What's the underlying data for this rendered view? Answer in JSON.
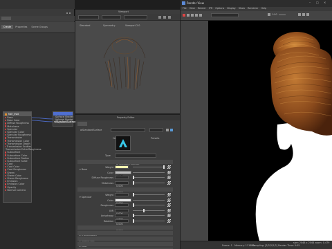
{
  "left_panel": {
    "tabs": [
      "Create",
      "Properties",
      "Scene Groups"
    ],
    "active_tab": "Create",
    "node_main": {
      "title": "hair_mat",
      "ports": [
        "Base",
        "Base Color",
        "Diffuse Roughness",
        "Metalness",
        "Specular",
        "Specular Color",
        "Specular Roughness",
        "Transmission",
        "Transmission Color",
        "Transmission Depth",
        "Transmission Scatter",
        "Transmission Extra Roughness",
        "Subsurface",
        "Subsurface Color",
        "Subsurface Radius",
        "Subsurface Scale",
        "Coat",
        "Coat Color",
        "Coat Roughness",
        "Sheen",
        "Sheen Color",
        "Sheen Roughness",
        "Emission",
        "Emission Color",
        "Opacity",
        "Normal Camera"
      ]
    },
    "node_shading": {
      "title": "aiStandardSurfaceSG",
      "ports": [
        "Surface Shader",
        "Volume Shader",
        "Displacement Shader"
      ]
    }
  },
  "viewport": {
    "title": "Viewport",
    "menus": [
      "View",
      "Shading",
      "Lighting",
      "Show",
      "Renderer",
      "Panels"
    ],
    "toolbar_dropdowns": [
      "Standard",
      "Symmetry",
      "Viewport 2.0"
    ]
  },
  "property_editor": {
    "title": "Property Editor",
    "node_label": "aiStandardSurface",
    "node_value": "Hair",
    "presets_label": "Presets",
    "type_label": "Type",
    "type_value": "ai Standard Surface",
    "sections": [
      {
        "name": "Base",
        "open": true,
        "rows": [
          {
            "label": "Weight",
            "value": "1.000",
            "highlight": true,
            "level": 1.0
          },
          {
            "label": "Color",
            "value": "",
            "swatch": "#bfbfbf"
          },
          {
            "label": "Diffuse Roughness",
            "value": "0.000",
            "level": 0.0
          },
          {
            "label": "Metalness",
            "value": "0.000",
            "level": 0.0
          }
        ]
      },
      {
        "name": "Specular",
        "open": true,
        "rows": [
          {
            "label": "Weight",
            "value": "0.000",
            "level": 0.0
          },
          {
            "label": "Color",
            "value": "",
            "swatch": "#e6e6e6"
          },
          {
            "label": "Roughness",
            "value": "0.000",
            "level": 0.0
          },
          {
            "label": "IOR",
            "value": "1.500",
            "level": 0.33
          },
          {
            "label": "Anisotropy",
            "value": "0.000",
            "level": 0.0
          },
          {
            "label": "Rotation",
            "value": "0.000",
            "level": 0.0
          }
        ]
      },
      {
        "name": "Transmission",
        "open": false,
        "rows": []
      },
      {
        "name": "Subsurface",
        "open": false,
        "rows": []
      },
      {
        "name": "Coat",
        "open": false,
        "rows": []
      },
      {
        "name": "Sheen",
        "open": false,
        "rows": []
      },
      {
        "name": "Emission",
        "open": false,
        "rows": []
      }
    ]
  },
  "render_view": {
    "title": "Render View",
    "menus": [
      "File",
      "View",
      "Render",
      "IPR",
      "Options",
      "Display",
      "Show",
      "Renderer",
      "Help"
    ],
    "dropdown": "Arnold Renderer",
    "zoom": "1:00",
    "status_left": "Frame: 1",
    "status_mem": "Memory: 1118Mb",
    "status_size": "size: 2048 x 2048 zoom: 0.479",
    "status_right": "Sampling: [3/2/2/2/2]  Render Time: 0:05"
  },
  "colors": {
    "hair_base": "#8a4a1c",
    "hair_highlight": "#c8782e",
    "render_bg": "#000000",
    "accent_blue": "#4f6fd1",
    "field_highlight": "#fff9b0"
  }
}
